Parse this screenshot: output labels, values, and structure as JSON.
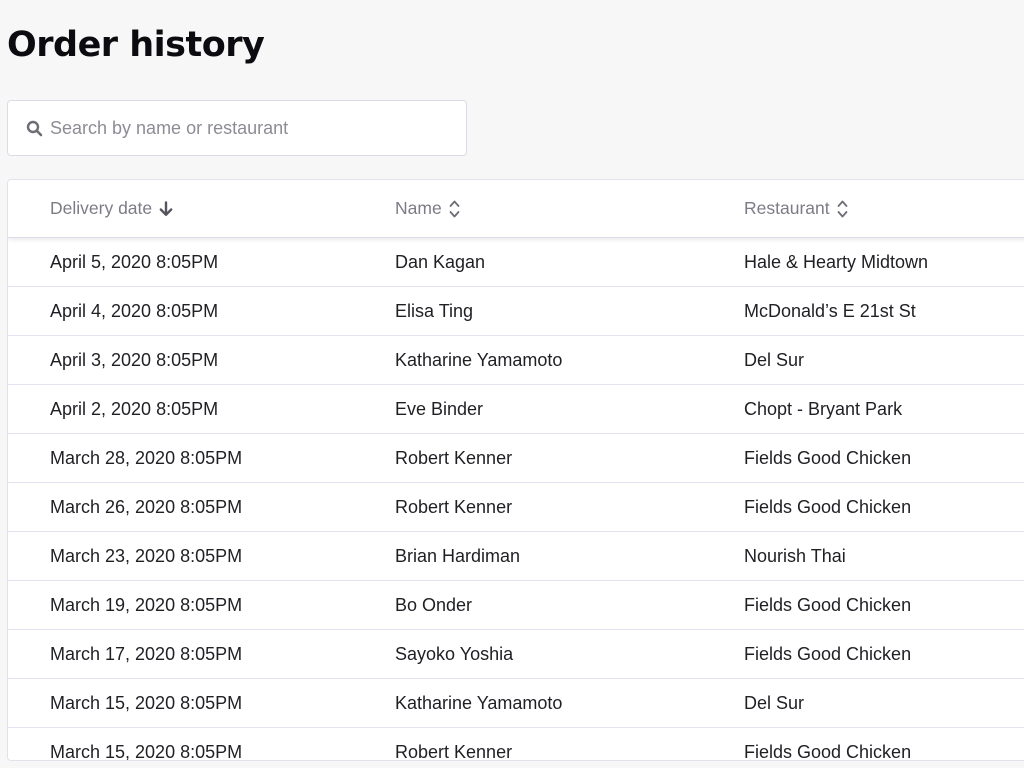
{
  "page": {
    "title": "Order history"
  },
  "search": {
    "placeholder": "Search by name or restaurant",
    "icon": "search-icon"
  },
  "table": {
    "columns": [
      {
        "key": "date",
        "label": "Delivery date",
        "sort": "desc",
        "sort_icon": "arrow-down-icon"
      },
      {
        "key": "name",
        "label": "Name",
        "sort": "none",
        "sort_icon": "sort-updown-icon"
      },
      {
        "key": "restaurant",
        "label": "Restaurant",
        "sort": "none",
        "sort_icon": "sort-updown-icon"
      }
    ],
    "rows": [
      {
        "date": "April 5, 2020 8:05PM",
        "name": "Dan Kagan",
        "restaurant": "Hale & Hearty Midtown"
      },
      {
        "date": "April 4, 2020 8:05PM",
        "name": "Elisa Ting",
        "restaurant": "McDonald’s E 21st St"
      },
      {
        "date": "April 3, 2020 8:05PM",
        "name": "Katharine Yamamoto",
        "restaurant": "Del Sur"
      },
      {
        "date": "April 2, 2020 8:05PM",
        "name": "Eve Binder",
        "restaurant": "Chopt - Bryant Park"
      },
      {
        "date": "March 28, 2020 8:05PM",
        "name": "Robert Kenner",
        "restaurant": "Fields Good Chicken"
      },
      {
        "date": "March 26, 2020 8:05PM",
        "name": "Robert Kenner",
        "restaurant": "Fields Good Chicken"
      },
      {
        "date": "March 23, 2020 8:05PM",
        "name": "Brian Hardiman",
        "restaurant": "Nourish Thai"
      },
      {
        "date": "March 19, 2020 8:05PM",
        "name": "Bo Onder",
        "restaurant": "Fields Good Chicken"
      },
      {
        "date": "March 17, 2020 8:05PM",
        "name": "Sayoko Yoshia",
        "restaurant": "Fields Good Chicken"
      },
      {
        "date": "March 15, 2020 8:05PM",
        "name": "Katharine Yamamoto",
        "restaurant": "Del Sur"
      },
      {
        "date": "March 15, 2020 8:05PM",
        "name": "Robert Kenner",
        "restaurant": "Fields Good Chicken"
      }
    ]
  },
  "colors": {
    "background": "#f7f7f8",
    "row_divider": "#e3e2f0",
    "header_text": "#7c7c86",
    "body_text": "#1f1f24"
  }
}
